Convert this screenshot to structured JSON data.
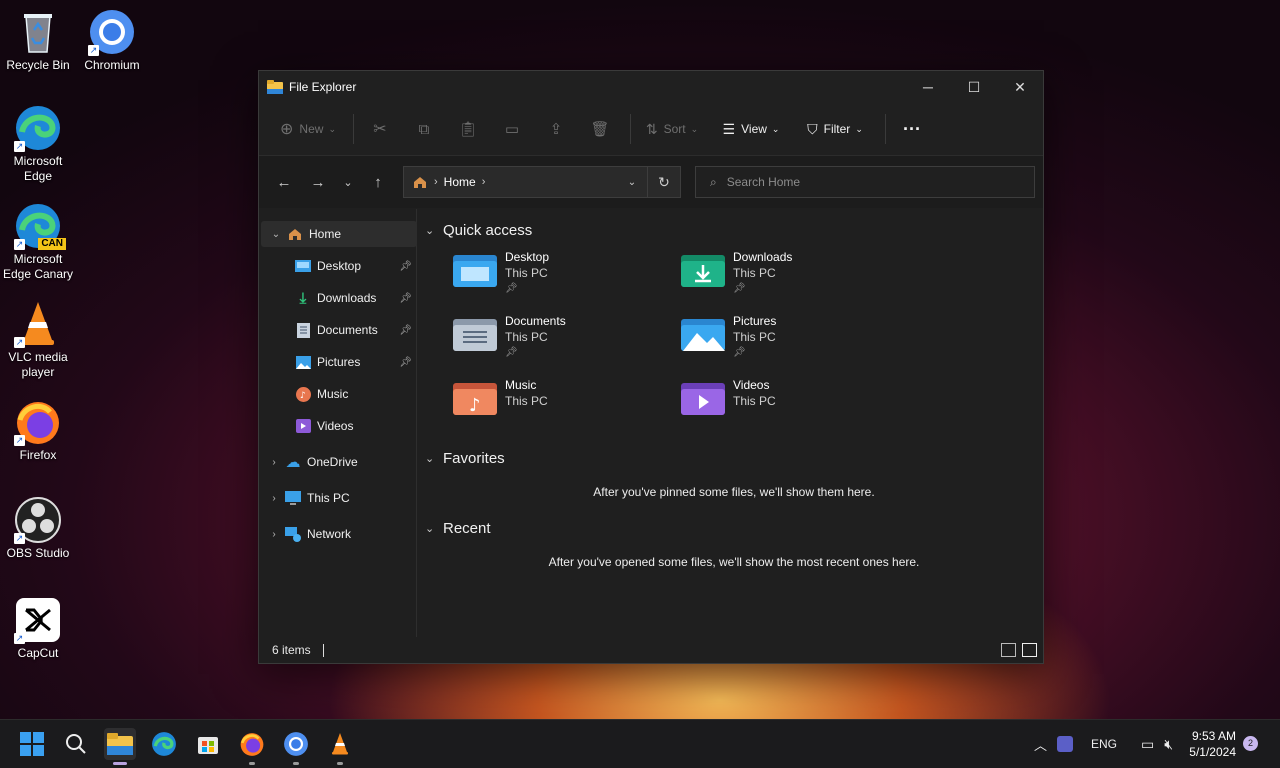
{
  "desktop": {
    "icons": [
      {
        "label": "Recycle Bin"
      },
      {
        "label": "Chromium"
      },
      {
        "label_line1": "Microsoft",
        "label_line2": "Edge"
      },
      {
        "label_line1": "Microsoft",
        "label_line2": "Edge Canary",
        "badge": "CAN"
      },
      {
        "label_line1": "VLC media",
        "label_line2": "player"
      },
      {
        "label": "Firefox"
      },
      {
        "label": "OBS Studio"
      },
      {
        "label": "CapCut"
      }
    ]
  },
  "window": {
    "title": "File Explorer",
    "toolbar": {
      "new_label": "New",
      "sort_label": "Sort",
      "view_label": "View",
      "filter_label": "Filter"
    },
    "address": {
      "location": "Home"
    },
    "search": {
      "placeholder": "Search Home"
    },
    "sidebar": {
      "home": "Home",
      "pinned": [
        {
          "label": "Desktop"
        },
        {
          "label": "Downloads"
        },
        {
          "label": "Documents"
        },
        {
          "label": "Pictures"
        },
        {
          "label": "Music"
        },
        {
          "label": "Videos"
        }
      ],
      "onedrive": "OneDrive",
      "thispc": "This PC",
      "network": "Network"
    },
    "quick_access": {
      "title": "Quick access",
      "items": [
        {
          "name": "Desktop",
          "location": "This PC"
        },
        {
          "name": "Downloads",
          "location": "This PC"
        },
        {
          "name": "Documents",
          "location": "This PC"
        },
        {
          "name": "Pictures",
          "location": "This PC"
        },
        {
          "name": "Music",
          "location": "This PC"
        },
        {
          "name": "Videos",
          "location": "This PC"
        }
      ]
    },
    "favorites": {
      "title": "Favorites",
      "empty_text": "After you've pinned some files, we'll show them here."
    },
    "recent": {
      "title": "Recent",
      "empty_text": "After you've opened some files, we'll show the most recent ones here."
    },
    "status": {
      "item_count": "6 items"
    }
  },
  "taskbar": {
    "language": "ENG",
    "time": "9:53 AM",
    "date": "5/1/2024",
    "notification_count": "2"
  },
  "colors": {
    "folder_blue": "#3aa0e8",
    "folder_green": "#1aa37a",
    "folder_music": "#e8764f",
    "folder_videos": "#8d5ad8",
    "accent": "#b9a2e0"
  }
}
